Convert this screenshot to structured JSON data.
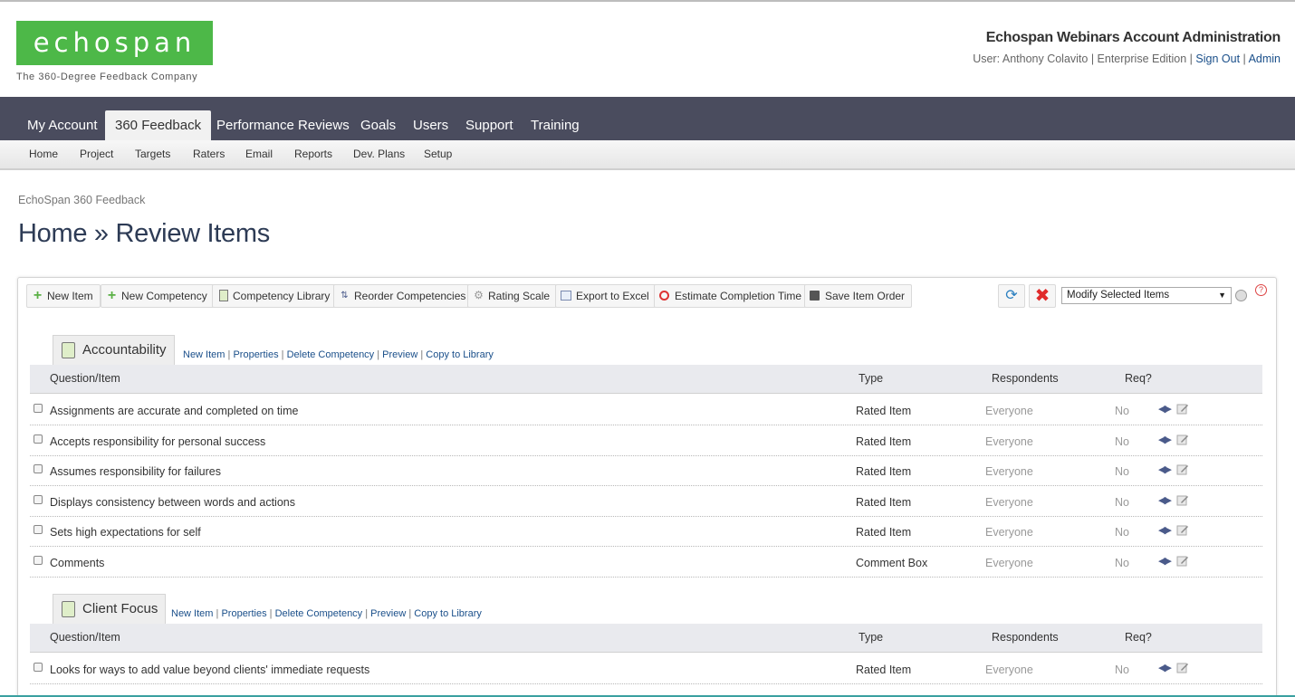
{
  "header": {
    "logo_text": "echospan",
    "logo_tagline": "The 360-Degree Feedback Company",
    "account_title": "Echospan Webinars Account Administration",
    "user_prefix": "User: Anthony Colavito | Enterprise Edition | ",
    "sign_out": "Sign Out",
    "separator": " | ",
    "admin": "Admin"
  },
  "main_nav": {
    "tabs": [
      "My Account",
      "360 Feedback",
      "Performance Reviews",
      "Goals",
      "Users",
      "Support",
      "Training"
    ],
    "active": "360 Feedback"
  },
  "sub_nav": [
    "Home",
    "Project",
    "Targets",
    "Raters",
    "Email",
    "Reports",
    "Dev. Plans",
    "Setup"
  ],
  "breadcrumb": "EchoSpan 360 Feedback",
  "page_title": "Home » Review Items",
  "toolbar": {
    "buttons": [
      "New Item",
      "New Competency",
      "Competency Library",
      "Reorder Competencies",
      "Rating Scale",
      "Export to Excel",
      "Estimate Completion Time",
      "Save Item Order"
    ],
    "select_value": "Modify Selected Items",
    "help": "?"
  },
  "table_headers": {
    "question": "Question/Item",
    "type": "Type",
    "respondents": "Respondents",
    "req": "Req?"
  },
  "competency_links": [
    "New Item",
    "Properties",
    "Delete Competency",
    "Preview",
    "Copy to Library"
  ],
  "competencies": [
    {
      "name": "Accountability",
      "items": [
        {
          "question": "Assignments are accurate and completed on time",
          "type": "Rated Item",
          "respondents": "Everyone",
          "req": "No"
        },
        {
          "question": "Accepts responsibility for personal success",
          "type": "Rated Item",
          "respondents": "Everyone",
          "req": "No"
        },
        {
          "question": "Assumes responsibility for failures",
          "type": "Rated Item",
          "respondents": "Everyone",
          "req": "No"
        },
        {
          "question": "Displays consistency between words and actions",
          "type": "Rated Item",
          "respondents": "Everyone",
          "req": "No"
        },
        {
          "question": "Sets high expectations for self",
          "type": "Rated Item",
          "respondents": "Everyone",
          "req": "No"
        },
        {
          "question": "Comments",
          "type": "Comment Box",
          "respondents": "Everyone",
          "req": "No"
        }
      ]
    },
    {
      "name": "Client Focus",
      "items": [
        {
          "question": "Looks for ways to add value beyond clients' immediate requests",
          "type": "Rated Item",
          "respondents": "Everyone",
          "req": "No"
        }
      ]
    }
  ],
  "colors": {
    "brand_green": "#4db848",
    "nav_bg": "#4a4c5e",
    "link": "#1a4f8a"
  }
}
